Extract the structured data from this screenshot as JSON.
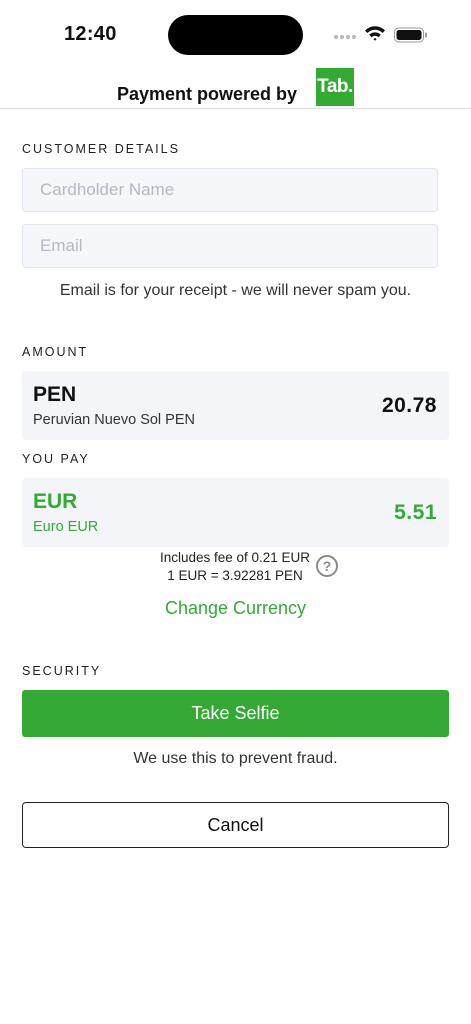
{
  "status_bar": {
    "time": "12:40"
  },
  "header": {
    "powered_by": "Payment powered by",
    "logo_text": "Tab."
  },
  "customer_details": {
    "label": "CUSTOMER DETAILS",
    "cardholder_name": {
      "placeholder": "Cardholder Name",
      "value": ""
    },
    "email": {
      "placeholder": "Email",
      "value": ""
    },
    "helper": "Email is for your receipt - we will never spam you."
  },
  "amount": {
    "label": "AMOUNT",
    "currency_code": "PEN",
    "currency_name": "Peruvian Nuevo Sol PEN",
    "value": "20.78"
  },
  "you_pay": {
    "label": "YOU PAY",
    "currency_code": "EUR",
    "currency_name": "Euro EUR",
    "value": "5.51",
    "fee_line": "Includes fee of 0.21 EUR",
    "rate_line": "1 EUR = 3.92281 PEN",
    "help_glyph": "?",
    "change_currency": "Change Currency"
  },
  "security": {
    "label": "SECURITY",
    "selfie_button": "Take Selfie",
    "helper": "We use this to prevent fraud."
  },
  "cancel_button": "Cancel",
  "colors": {
    "accent": "#34aa35",
    "field_bg": "#f6f7fb",
    "panel_bg": "#f4f5f8"
  },
  "icons": [
    "cellular-signal-icon",
    "wifi-icon",
    "battery-icon",
    "help-circle-icon"
  ]
}
